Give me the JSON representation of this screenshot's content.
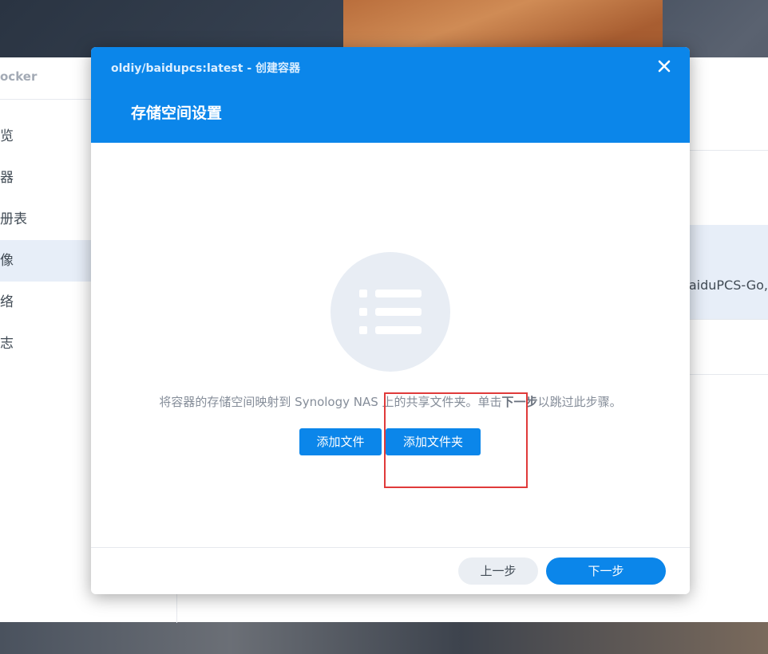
{
  "background_app": {
    "title": "ocker",
    "nav_items": [
      {
        "label": "览"
      },
      {
        "label": "器"
      },
      {
        "label": "册表"
      },
      {
        "label": "像"
      },
      {
        "label": "络"
      },
      {
        "label": "志"
      }
    ],
    "active_nav_index": 3,
    "row_text": "aiduPCS-Go,"
  },
  "dialog": {
    "title": "oldiy/baidupcs:latest - 创建容器",
    "heading": "存储空间设置",
    "description_before": "将容器的存储空间映射到 Synology NAS 上的共享文件夹。单击",
    "description_bold": "下一步",
    "description_after": "以跳过此步骤。",
    "empty_state_icon": "list-icon",
    "close_icon": "close-icon",
    "buttons": {
      "add_file": "添加文件",
      "add_folder": "添加文件夹",
      "previous": "上一步",
      "next": "下一步"
    }
  },
  "colors": {
    "accent": "#0b86ea",
    "annotation": "#e03a3a"
  }
}
